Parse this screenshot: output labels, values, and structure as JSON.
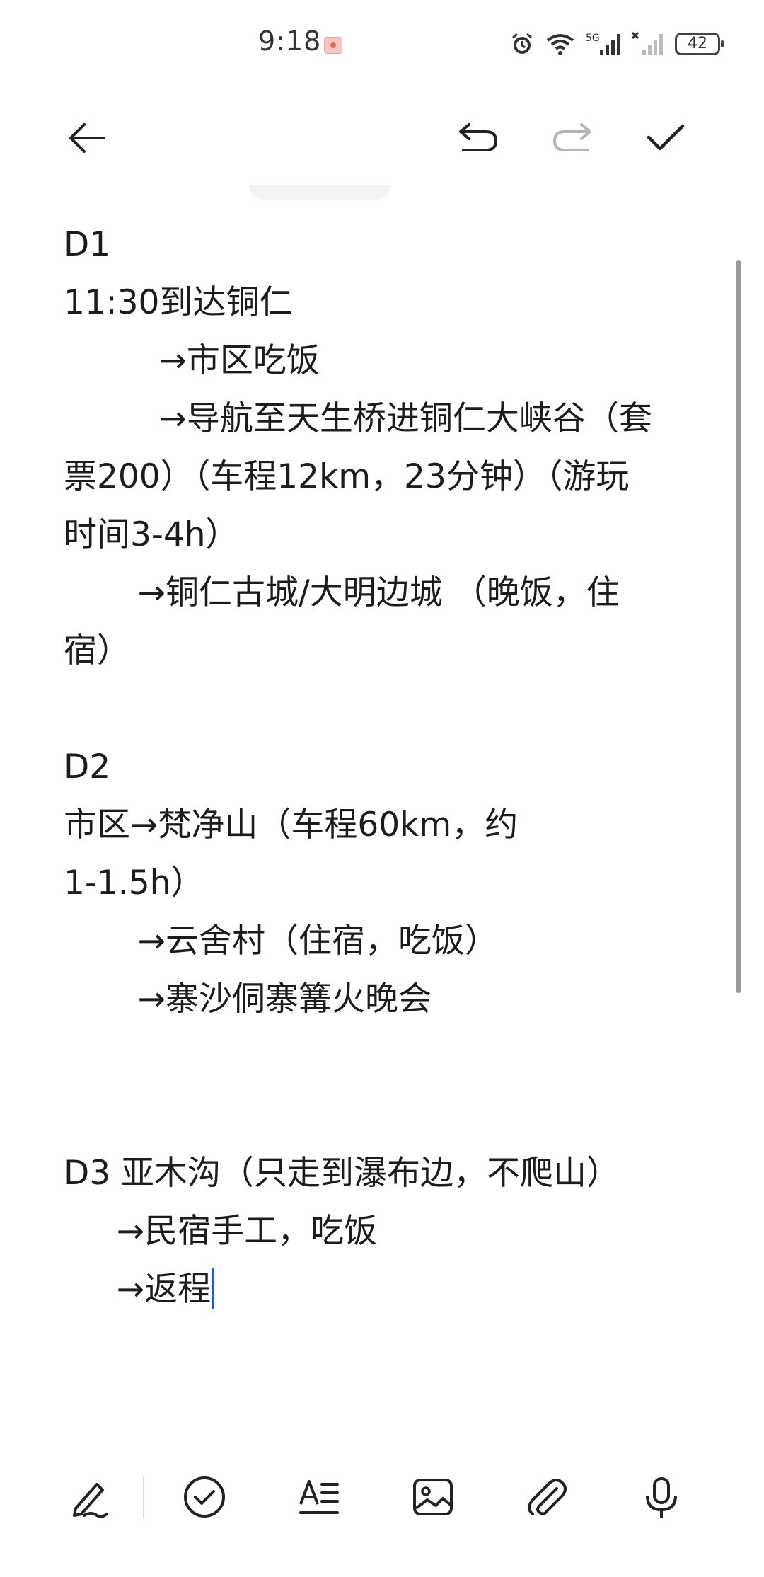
{
  "status": {
    "time": "9:18",
    "battery": "42",
    "signal_label": "5G"
  },
  "toolbar": {
    "back": "back-arrow-icon",
    "undo": "undo-icon",
    "redo": "redo-icon",
    "done": "checkmark-icon"
  },
  "note": {
    "lines": [
      "D1",
      "11:30到达铜仁",
      "         →市区吃饭",
      "         →导航至天生桥进铜仁大峡谷（套",
      "票200）（车程12km，23分钟）（游玩",
      "时间3-4h）",
      "       →铜仁古城/大明边城 （晚饭，住",
      "宿）",
      "",
      "D2",
      "市区→梵净山（车程60km，约",
      "1-1.5h）",
      "       →云舍村（住宿，吃饭）",
      "       →寨沙侗寨篝火晚会",
      "",
      "",
      "D3 亚木沟（只走到瀑布边，不爬山）",
      "     →民宿手工，吃饭",
      "     →返程"
    ]
  },
  "bottom_tools": [
    "pen-icon",
    "checklist-icon",
    "text-format-icon",
    "image-icon",
    "attachment-icon",
    "microphone-icon"
  ],
  "colors": {
    "caret": "#1f5bdc",
    "text": "#1c1c1c",
    "icon": "#222222",
    "disabled_icon": "#b5b5b5"
  }
}
